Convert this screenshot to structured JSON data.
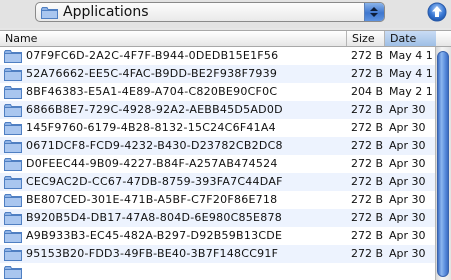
{
  "location": {
    "current": "Applications",
    "folder_icon": "folder-icon",
    "arrows_icon": "up-down-arrows-icon"
  },
  "toolbar": {
    "up_icon": "up-arrow-icon"
  },
  "columns": {
    "name": "Name",
    "size": "Size",
    "date": "Date"
  },
  "colors": {
    "accent": "#3f77cf",
    "folder": "#8fb3e6",
    "stripe": "#edf3fe"
  },
  "files": [
    {
      "name": "07F9FC6D-2A2C-4F7F-B944-0DEDB15E1F56",
      "size": "272 B",
      "date": "May 4 1"
    },
    {
      "name": "52A76662-EE5C-4FAC-B9DD-BE2F938F7939",
      "size": "272 B",
      "date": "May 4 1"
    },
    {
      "name": "8BF46383-E5A1-4E89-A704-C820BE90CF0C",
      "size": "204 B",
      "date": "May 2 1"
    },
    {
      "name": "6866B8E7-729C-4928-92A2-AEBB45D5AD0D",
      "size": "272 B",
      "date": "Apr 30"
    },
    {
      "name": "145F9760-6179-4B28-8132-15C24C6F41A4",
      "size": "272 B",
      "date": "Apr 30"
    },
    {
      "name": "0671DCF8-FCD9-4232-B430-D23782CB2DC8",
      "size": "272 B",
      "date": "Apr 30"
    },
    {
      "name": "D0FEEC44-9B09-4227-B84F-A257AB474524",
      "size": "272 B",
      "date": "Apr 30"
    },
    {
      "name": "CEC9AC2D-CC67-47DB-8759-393FA7C44DAF",
      "size": "272 B",
      "date": "Apr 30"
    },
    {
      "name": "BE807CED-301E-471B-A5BF-C7F20F86E718",
      "size": "272 B",
      "date": "Apr 30"
    },
    {
      "name": "B920B5D4-DB17-47A8-804D-6E980C85E878",
      "size": "272 B",
      "date": "Apr 30"
    },
    {
      "name": "A9B933B3-EC45-482A-B297-D92B59B13CDE",
      "size": "272 B",
      "date": "Apr 30"
    },
    {
      "name": "95153B20-FDD3-49FB-BE40-3B7F148CC91F",
      "size": "272 B",
      "date": "Apr 30"
    },
    {
      "name": "",
      "size": "",
      "date": ""
    }
  ]
}
